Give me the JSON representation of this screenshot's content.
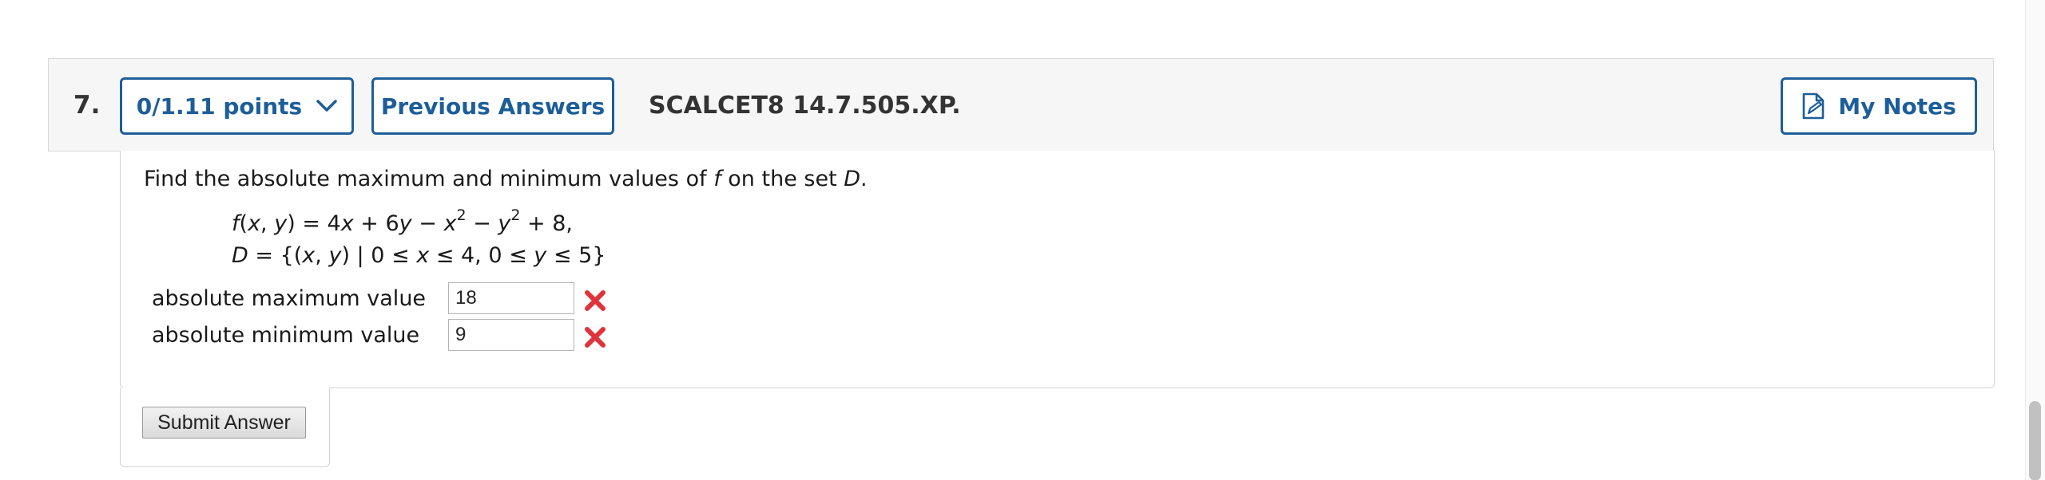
{
  "question": {
    "number": "7.",
    "points_label": "0/1.11 points",
    "previous_answers_label": "Previous Answers",
    "code": "SCALCET8 14.7.505.XP.",
    "my_notes_label": "My Notes"
  },
  "body": {
    "prompt_pre": "Find the absolute maximum and minimum values of ",
    "prompt_f": "f",
    "prompt_mid": " on the set ",
    "prompt_D": "D",
    "prompt_end": ".",
    "eq1": {
      "f": "f",
      "args_open": "(",
      "x": "x",
      "comma": ", ",
      "y": "y",
      "args_close": ")",
      "rhs_1": " = 4",
      "rhs_x": "x",
      "rhs_2": " + 6",
      "rhs_y": "y",
      "rhs_3": " − ",
      "rhs_x2": "x",
      "sup1": "2",
      "rhs_4": " − ",
      "rhs_y2": "y",
      "sup2": "2",
      "rhs_5": " + 8,"
    },
    "eq2": {
      "D": "D",
      "p1": " = {(",
      "x": "x",
      "p2": ", ",
      "y": "y",
      "p3": ") | 0 ≤ ",
      "x2": "x",
      "p4": " ≤ 4, 0 ≤ ",
      "y2": "y",
      "p5": " ≤ 5}"
    },
    "max_label": "absolute maximum value",
    "max_value": "18",
    "min_label": "absolute minimum value",
    "min_value": "9",
    "submit_label": "Submit Answer"
  },
  "colors": {
    "accent": "#1d5e99",
    "incorrect": "#e0333c"
  },
  "icons": {
    "points_toggle": "chevron-down-icon",
    "notes": "note-icon",
    "incorrect": "incorrect-x-icon"
  }
}
